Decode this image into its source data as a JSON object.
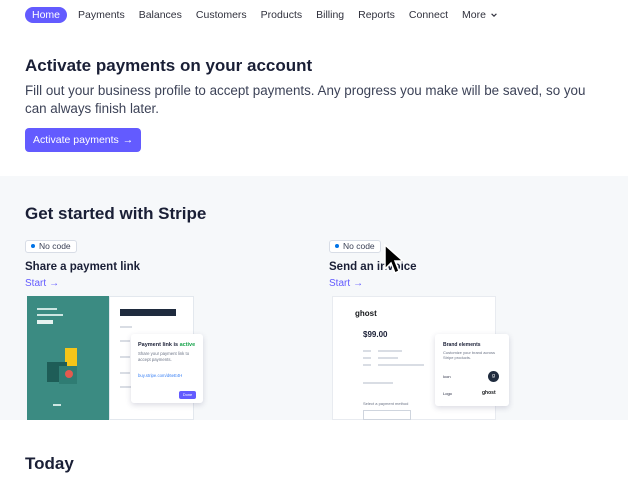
{
  "nav": {
    "items": [
      "Home",
      "Payments",
      "Balances",
      "Customers",
      "Products",
      "Billing",
      "Reports",
      "Connect",
      "More"
    ],
    "active": "Home"
  },
  "activate": {
    "title": "Activate payments on your account",
    "description": "Fill out your business profile to accept payments. Any progress you make will be saved, so you can always finish later.",
    "button_label": "Activate payments",
    "button_arrow": "→"
  },
  "get_started": {
    "title": "Get started with Stripe",
    "cards": [
      {
        "badge": "No code",
        "title": "Share a payment link",
        "link": "Start",
        "illustration": {
          "popup_title": "Payment link is",
          "popup_status": "active",
          "popup_text": "Share your payment link to accept payments.",
          "popup_url": "buy.stripe.com/d6eE4H",
          "popup_button": "Done"
        }
      },
      {
        "badge": "No code",
        "title": "Send an invoice",
        "link": "Start",
        "illustration": {
          "brand": "ghost",
          "amount": "$99.00",
          "payment_method_label": "Select a payment method",
          "popup_title": "Brand elements",
          "popup_text": "Customize your brand across Stripe products.",
          "popup_icon_label": "Icon",
          "popup_logo_label": "Logo",
          "popup_logo": "ghost"
        }
      }
    ]
  },
  "today": {
    "title": "Today"
  },
  "colors": {
    "accent": "#635bff",
    "teal": "#3b8b82",
    "dark": "#1a1f36"
  }
}
